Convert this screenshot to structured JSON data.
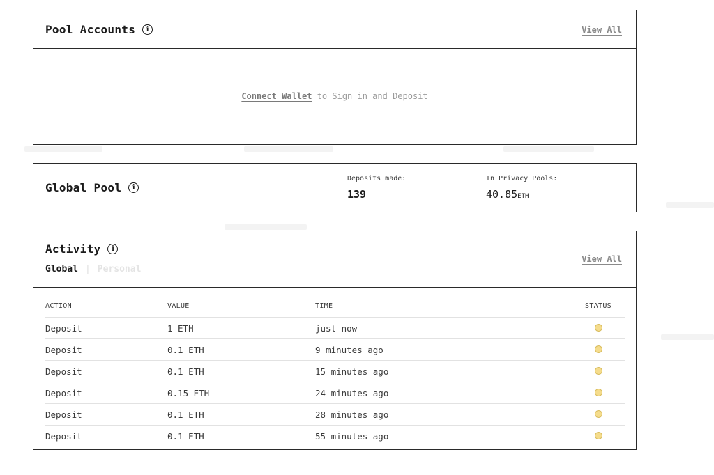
{
  "colors": {
    "status_pending": "#f5dc8c",
    "border": "#2a2a2a"
  },
  "pool_accounts": {
    "title": "Pool Accounts",
    "info_icon": "info-icon",
    "view_all": "View All",
    "connect_link": "Connect Wallet",
    "empty_message": " to Sign in and Deposit"
  },
  "global_pool": {
    "title": "Global Pool",
    "info_icon": "info-icon",
    "deposits_label": "Deposits made:",
    "deposits_value": "139",
    "privacy_label": "In Privacy Pools:",
    "privacy_value": "40.85",
    "privacy_unit": "ETH"
  },
  "activity": {
    "title": "Activity",
    "info_icon": "info-icon",
    "view_all": "View All",
    "tabs": [
      "Global",
      "Personal"
    ],
    "columns": [
      "ACTION",
      "VALUE",
      "TIME",
      "STATUS"
    ],
    "rows": [
      {
        "action": "Deposit",
        "value": "1 ETH",
        "time": "just now",
        "status": "pending"
      },
      {
        "action": "Deposit",
        "value": "0.1 ETH",
        "time": "9 minutes ago",
        "status": "pending"
      },
      {
        "action": "Deposit",
        "value": "0.1 ETH",
        "time": "15 minutes ago",
        "status": "pending"
      },
      {
        "action": "Deposit",
        "value": "0.15 ETH",
        "time": "24 minutes ago",
        "status": "pending"
      },
      {
        "action": "Deposit",
        "value": "0.1 ETH",
        "time": "28 minutes ago",
        "status": "pending"
      },
      {
        "action": "Deposit",
        "value": "0.1 ETH",
        "time": "55 minutes ago",
        "status": "pending"
      }
    ]
  }
}
